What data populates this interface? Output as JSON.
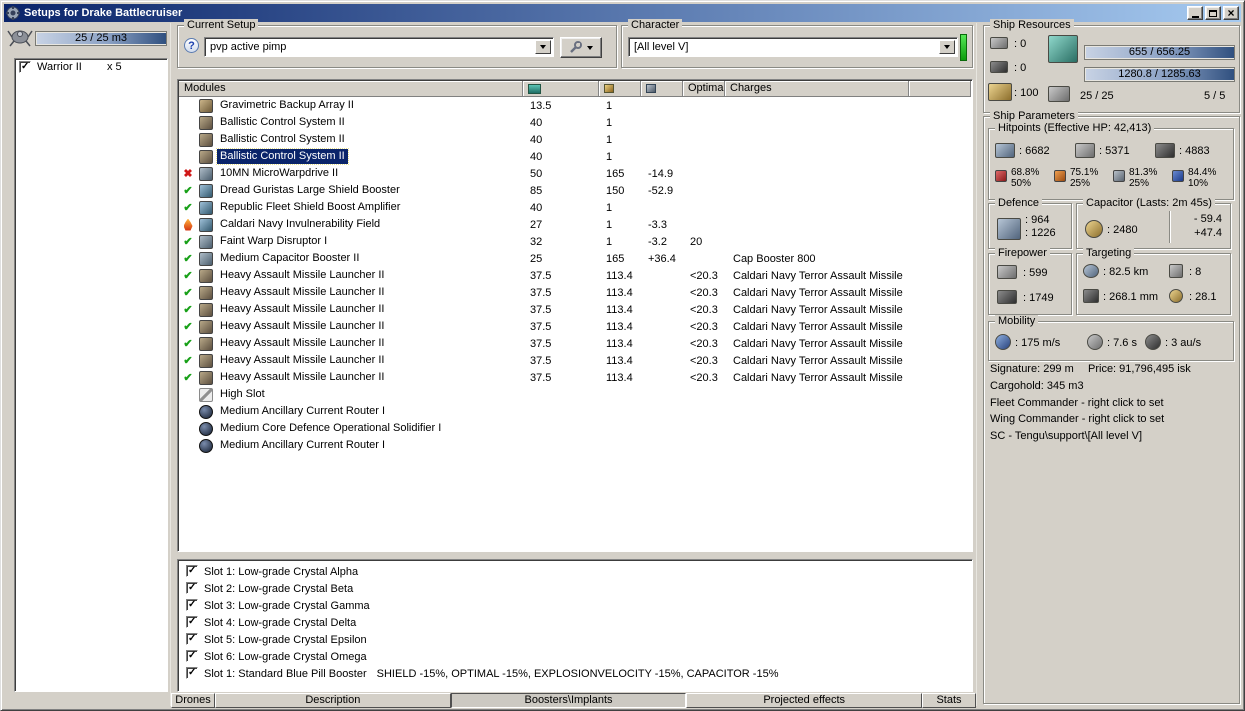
{
  "window": {
    "title": "Setups for Drake Battlecruiser"
  },
  "drone_bay": {
    "capacity": "25 / 25 m3",
    "items": [
      {
        "name": "Warrior II",
        "qty": "x 5"
      }
    ]
  },
  "setup": {
    "label": "Current Setup",
    "value": "pvp active pimp"
  },
  "character": {
    "label": "Character",
    "value": "[All level V]"
  },
  "modules": {
    "headers": {
      "name": "Modules",
      "optimal": "Optimal",
      "charges": "Charges"
    },
    "rows": [
      {
        "status": "",
        "icon": "mod-a",
        "state": "",
        "name": "Gravimetric Backup Array II",
        "cpu": "13.5",
        "pg": "1",
        "cap": "",
        "optimal": "",
        "charges": ""
      },
      {
        "status": "",
        "icon": "mod-b",
        "state": "",
        "name": "Ballistic Control System II",
        "cpu": "40",
        "pg": "1",
        "cap": "",
        "optimal": "",
        "charges": ""
      },
      {
        "status": "",
        "icon": "mod-b",
        "state": "",
        "name": "Ballistic Control System II",
        "cpu": "40",
        "pg": "1",
        "cap": "",
        "optimal": "",
        "charges": ""
      },
      {
        "status": "",
        "icon": "mod-b",
        "state": "selected",
        "name": "Ballistic Control System II",
        "cpu": "40",
        "pg": "1",
        "cap": "",
        "optimal": "",
        "charges": ""
      },
      {
        "status": "err",
        "icon": "mod-c",
        "state": "",
        "name": "10MN MicroWarpdrive II",
        "cpu": "50",
        "pg": "165",
        "cap": "-14.9",
        "optimal": "",
        "charges": ""
      },
      {
        "status": "ok",
        "icon": "mod-d",
        "state": "",
        "name": "Dread Guristas Large Shield Booster",
        "cpu": "85",
        "pg": "150",
        "cap": "-52.9",
        "optimal": "",
        "charges": ""
      },
      {
        "status": "ok",
        "icon": "mod-d",
        "state": "",
        "name": "Republic Fleet Shield Boost Amplifier",
        "cpu": "40",
        "pg": "1",
        "cap": "",
        "optimal": "",
        "charges": ""
      },
      {
        "status": "burn",
        "icon": "mod-d",
        "state": "",
        "name": "Caldari Navy Invulnerability Field",
        "cpu": "27",
        "pg": "1",
        "cap": "-3.3",
        "optimal": "",
        "charges": ""
      },
      {
        "status": "ok",
        "icon": "mod-c",
        "state": "",
        "name": "Faint Warp Disruptor I",
        "cpu": "32",
        "pg": "1",
        "cap": "-3.2",
        "optimal": "20",
        "charges": ""
      },
      {
        "status": "ok",
        "icon": "mod-c",
        "state": "",
        "name": "Medium Capacitor Booster II",
        "cpu": "25",
        "pg": "165",
        "cap": "+36.4",
        "optimal": "",
        "charges": "Cap Booster 800"
      },
      {
        "status": "ok",
        "icon": "mod-b",
        "state": "",
        "name": "Heavy Assault Missile Launcher II",
        "cpu": "37.5",
        "pg": "113.4",
        "cap": "",
        "optimal": "<20.3",
        "charges": "Caldari Navy Terror Assault Missile"
      },
      {
        "status": "ok",
        "icon": "mod-b",
        "state": "",
        "name": "Heavy Assault Missile Launcher II",
        "cpu": "37.5",
        "pg": "113.4",
        "cap": "",
        "optimal": "<20.3",
        "charges": "Caldari Navy Terror Assault Missile"
      },
      {
        "status": "ok",
        "icon": "mod-b",
        "state": "",
        "name": "Heavy Assault Missile Launcher II",
        "cpu": "37.5",
        "pg": "113.4",
        "cap": "",
        "optimal": "<20.3",
        "charges": "Caldari Navy Terror Assault Missile"
      },
      {
        "status": "ok",
        "icon": "mod-b",
        "state": "",
        "name": "Heavy Assault Missile Launcher II",
        "cpu": "37.5",
        "pg": "113.4",
        "cap": "",
        "optimal": "<20.3",
        "charges": "Caldari Navy Terror Assault Missile"
      },
      {
        "status": "ok",
        "icon": "mod-b",
        "state": "",
        "name": "Heavy Assault Missile Launcher II",
        "cpu": "37.5",
        "pg": "113.4",
        "cap": "",
        "optimal": "<20.3",
        "charges": "Caldari Navy Terror Assault Missile"
      },
      {
        "status": "ok",
        "icon": "mod-b",
        "state": "",
        "name": "Heavy Assault Missile Launcher II",
        "cpu": "37.5",
        "pg": "113.4",
        "cap": "",
        "optimal": "<20.3",
        "charges": "Caldari Navy Terror Assault Missile"
      },
      {
        "status": "ok",
        "icon": "mod-b",
        "state": "",
        "name": "Heavy Assault Missile Launcher II",
        "cpu": "37.5",
        "pg": "113.4",
        "cap": "",
        "optimal": "<20.3",
        "charges": "Caldari Navy Terror Assault Missile"
      },
      {
        "status": "",
        "icon": "wrench",
        "state": "",
        "name": "High Slot",
        "cpu": "",
        "pg": "",
        "cap": "",
        "optimal": "",
        "charges": ""
      },
      {
        "status": "",
        "icon": "rig",
        "state": "",
        "name": "Medium Ancillary Current Router I",
        "cpu": "",
        "pg": "",
        "cap": "",
        "optimal": "",
        "charges": ""
      },
      {
        "status": "",
        "icon": "rig",
        "state": "",
        "name": "Medium Core Defence Operational Solidifier I",
        "cpu": "",
        "pg": "",
        "cap": "",
        "optimal": "",
        "charges": ""
      },
      {
        "status": "",
        "icon": "rig",
        "state": "",
        "name": "Medium Ancillary Current Router I",
        "cpu": "",
        "pg": "",
        "cap": "",
        "optimal": "",
        "charges": ""
      }
    ]
  },
  "boosters": {
    "items": [
      {
        "label": "Slot 1: Low-grade Crystal Alpha",
        "effects": ""
      },
      {
        "label": "Slot 2: Low-grade Crystal Beta",
        "effects": ""
      },
      {
        "label": "Slot 3: Low-grade Crystal Gamma",
        "effects": ""
      },
      {
        "label": "Slot 4: Low-grade Crystal Delta",
        "effects": ""
      },
      {
        "label": "Slot 5: Low-grade Crystal Epsilon",
        "effects": ""
      },
      {
        "label": "Slot 6: Low-grade Crystal Omega",
        "effects": ""
      },
      {
        "label": "Slot 1: Standard Blue Pill Booster",
        "effects": "SHIELD -15%, OPTIMAL -15%, EXPLOSIONVELOCITY -15%, CAPACITOR -15%"
      }
    ]
  },
  "tabs": [
    {
      "id": "tab-drones",
      "label": "Drones",
      "cls": "t-sm",
      "state": ""
    },
    {
      "id": "tab-description",
      "label": "Description",
      "cls": "t-lg",
      "state": ""
    },
    {
      "id": "tab-boosters-implants",
      "label": "Boosters\\Implants",
      "cls": "t-lg",
      "state": "active"
    },
    {
      "id": "tab-projected-effects",
      "label": "Projected effects",
      "cls": "t-lg",
      "state": ""
    },
    {
      "id": "tab-stats",
      "label": "Stats",
      "cls": "t-sm2",
      "state": ""
    }
  ],
  "ship_resources": {
    "label": "Ship Resources",
    "turrets": ": 0",
    "launchers": ": 0",
    "calibration": ": 100",
    "cpu": "655 / 656.25",
    "powergrid": "1280.8 / 1285.63",
    "drones": "25 / 25",
    "rigs": "5 / 5"
  },
  "ship_parameters": {
    "label": "Ship Parameters",
    "hitpoints": {
      "label": "Hitpoints (Effective HP: 42,413)",
      "shield": ": 6682",
      "armor": ": 5371",
      "hull": ": 4883",
      "resists": [
        {
          "type": "em",
          "icon": "em-resist-icon",
          "shield": "68.8%",
          "armor": "50%"
        },
        {
          "type": "thermal",
          "icon": "thermal-resist-icon",
          "shield": "75.1%",
          "armor": "25%"
        },
        {
          "type": "kinetic",
          "icon": "kinetic-resist-icon",
          "shield": "81.3%",
          "armor": "25%"
        },
        {
          "type": "explosive",
          "icon": "explosive-resist-icon",
          "shield": "84.4%",
          "armor": "10%"
        }
      ]
    },
    "defence": {
      "label": "Defence",
      "boost": ": 964",
      "sustain": ": 1226"
    },
    "capacitor": {
      "label": "Capacitor (Lasts: 2m 45s)",
      "amount": ": 2480",
      "drain": "- 59.4",
      "recharge": "+47.4"
    },
    "firepower": {
      "label": "Firepower",
      "dps": ": 599",
      "volley": ": 1749"
    },
    "targeting": {
      "label": "Targeting",
      "range": ": 82.5 km",
      "max_targets": ": 8",
      "scan_resolution": ": 268.1 mm",
      "sensor_strength": ": 28.1"
    },
    "mobility": {
      "label": "Mobility",
      "speed": ": 175 m/s",
      "align_time": ": 7.6 s",
      "warp_speed": ": 3 au/s"
    },
    "signature": "Signature: 299 m",
    "price": "Price: 91,796,495 isk",
    "cargohold": "Cargohold: 345 m3",
    "fleet_commander": "Fleet Commander - right click to set",
    "wing_commander": "Wing Commander - right click to set",
    "squad_commander": "SC - Tengu\\support\\[All level V]"
  }
}
